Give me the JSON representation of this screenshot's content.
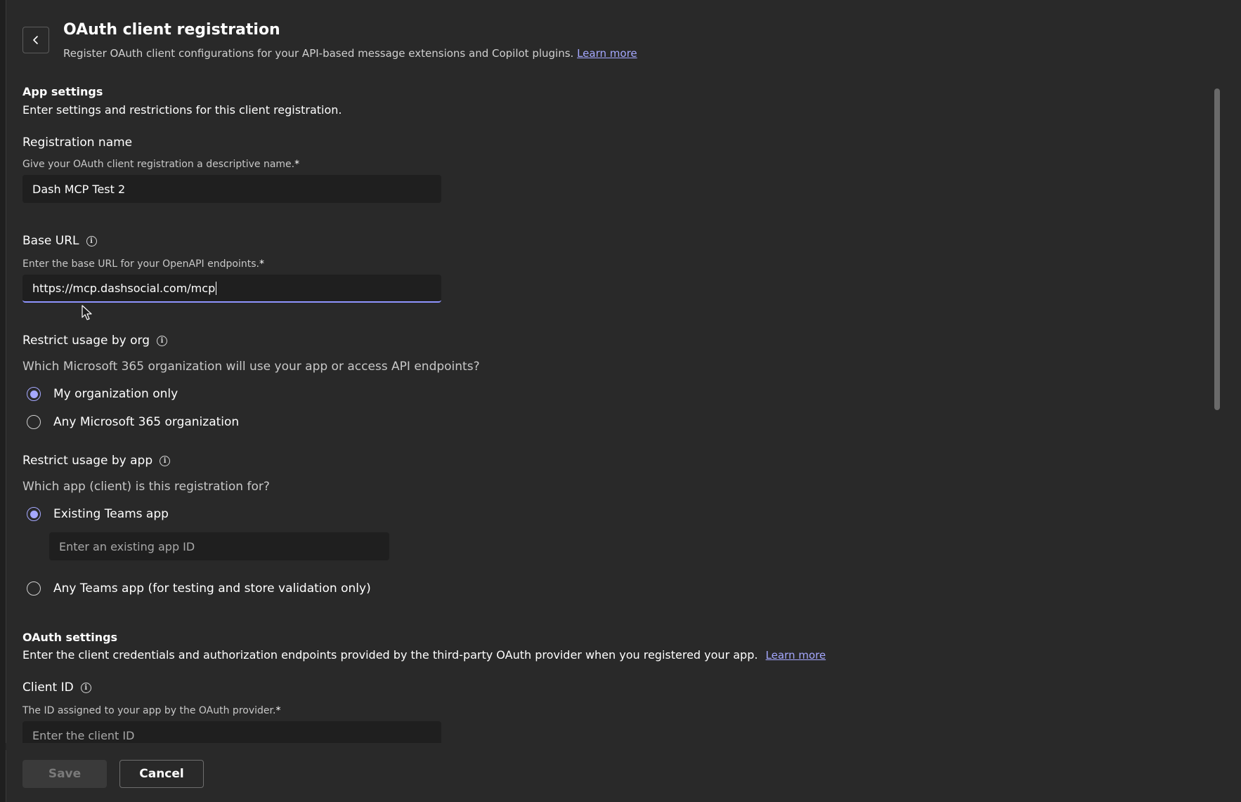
{
  "header": {
    "title": "OAuth client registration",
    "subtitle": "Register OAuth client configurations for your API-based message extensions and Copilot plugins.",
    "learn_more": "Learn more"
  },
  "app_settings": {
    "title": "App settings",
    "description": "Enter settings and restrictions for this client registration.",
    "registration_name": {
      "label": "Registration name",
      "hint": "Give your OAuth client registration a descriptive name.",
      "required_mark": "*",
      "value": "Dash MCP Test 2"
    },
    "base_url": {
      "label": "Base URL",
      "hint": "Enter the base URL for your OpenAPI endpoints.",
      "required_mark": "*",
      "value": "https://mcp.dashsocial.com/mcp"
    },
    "restrict_org": {
      "label": "Restrict usage by org",
      "question": "Which Microsoft 365 organization will use your app or access API endpoints?",
      "options": [
        "My organization only",
        "Any Microsoft 365 organization"
      ],
      "selected": "My organization only"
    },
    "restrict_app": {
      "label": "Restrict usage by app",
      "question": "Which app (client) is this registration for?",
      "options": [
        "Existing Teams app",
        "Any Teams app (for testing and store validation only)"
      ],
      "selected": "Existing Teams app",
      "app_id_placeholder": "Enter an existing app ID"
    }
  },
  "oauth_settings": {
    "title": "OAuth settings",
    "description": "Enter the client credentials and authorization endpoints provided by the third-party OAuth provider when you registered your app.",
    "learn_more": "Learn more",
    "client_id": {
      "label": "Client ID",
      "hint": "The ID assigned to your app by the OAuth provider.",
      "required_mark": "*",
      "placeholder": "Enter the client ID"
    }
  },
  "footer": {
    "save_label": "Save",
    "cancel_label": "Cancel"
  },
  "colors": {
    "accent": "#a5a8ff",
    "background": "#292929",
    "input_background": "#1f1f1f"
  }
}
